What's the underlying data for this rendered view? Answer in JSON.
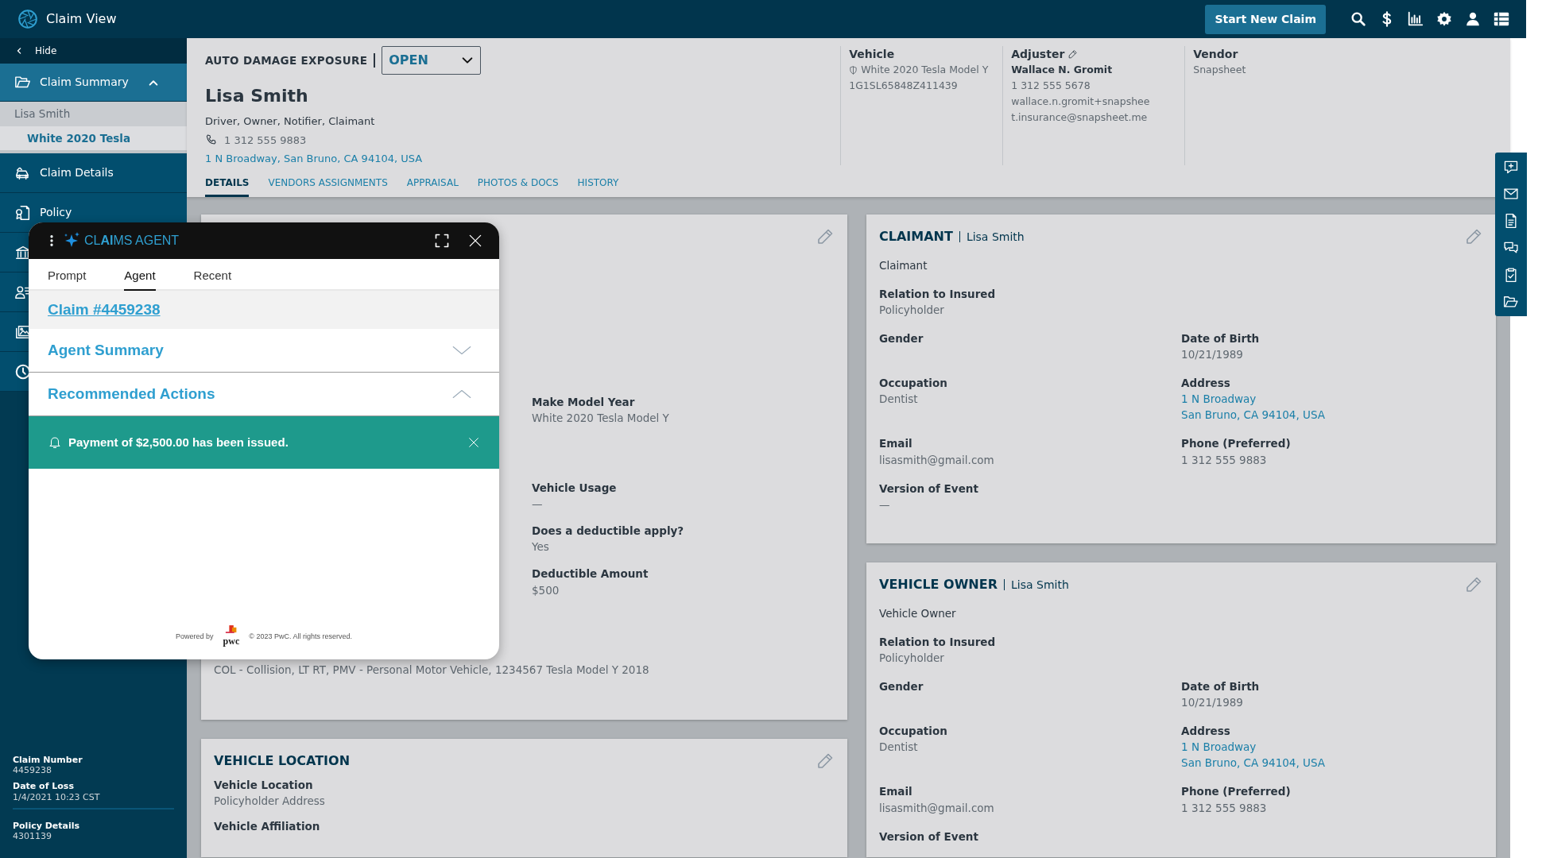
{
  "topbar": {
    "title": "Claim View",
    "start_button": "Start New Claim"
  },
  "sidebar": {
    "hide": "Hide",
    "items": [
      {
        "kind": "group",
        "label": "Claim Summary",
        "selected": true,
        "expanded": true,
        "children": [
          {
            "label": "Lisa Smith",
            "selected": false
          },
          {
            "label": "White 2020 Tesla",
            "selected": true
          }
        ]
      },
      {
        "kind": "item",
        "label": "Claim Details",
        "selected": false
      },
      {
        "kind": "item",
        "label": "Policy",
        "selected": false
      }
    ],
    "details": [
      {
        "label": "Claim Number",
        "value": "4459238"
      },
      {
        "label": "Date of Loss",
        "value": "1/4/2021 10:23 CST"
      },
      {
        "label": "Policy Details",
        "value": "4301139"
      }
    ]
  },
  "header": {
    "exposure": "AUTO DAMAGE EXPOSURE",
    "status": "OPEN",
    "name": "Lisa Smith",
    "roles": "Driver, Owner, Notifier, Claimant",
    "phone": "1 312 555 9883",
    "address": "1 N Broadway, San Bruno, CA 94104, USA",
    "info": [
      {
        "title": "Vehicle",
        "editable": false,
        "lines": [
          {
            "text": "White 2020 Tesla Model Y",
            "kind": "shield"
          },
          {
            "text": "1G1SL65848Z411439",
            "kind": "plain"
          }
        ]
      },
      {
        "title": "Adjuster",
        "editable": true,
        "lines": [
          {
            "text": "Wallace N. Gromit",
            "kind": "bold"
          },
          {
            "text": "1 312 555 5678",
            "kind": "plain"
          },
          {
            "text": "wallace.n.gromit+snapsheet.insurance@snapsheet.me",
            "kind": "plain"
          }
        ]
      },
      {
        "title": "Vendor",
        "editable": false,
        "lines": [
          {
            "text": "Snapsheet",
            "kind": "plain"
          }
        ]
      }
    ],
    "tabs": [
      {
        "label": "DETAILS",
        "selected": true
      },
      {
        "label": "VENDORS ASSIGNMENTS",
        "selected": false
      },
      {
        "label": "APPRAISAL",
        "selected": false
      },
      {
        "label": "PHOTOS & DOCS",
        "selected": false
      },
      {
        "label": "HISTORY",
        "selected": false
      }
    ]
  },
  "vehicle_card": {
    "fields": [
      {
        "label": "Make Model Year",
        "value": "White 2020 Tesla Model Y"
      },
      {
        "label": "Vehicle Usage",
        "value": "—"
      },
      {
        "label": "Does a deductible apply?",
        "value": "Yes"
      },
      {
        "label": "Deductible Amount",
        "value": "$500"
      }
    ],
    "coverage": "COL - Collision, LT RT, PMV - Personal Motor Vehicle, 1234567 Tesla Model Y 2018"
  },
  "location_card": {
    "title": "VEHICLE LOCATION",
    "fields": [
      {
        "label": "Vehicle Location",
        "value": "Policyholder Address"
      },
      {
        "label": "Vehicle Affiliation"
      }
    ]
  },
  "party_cards": [
    {
      "title": "CLAIMANT",
      "name": "Lisa Smith",
      "role": "Claimant",
      "rows": [
        [
          {
            "label": "Relation to Insured",
            "value": [
              "Policyholder"
            ]
          }
        ],
        [
          {
            "label": "Gender"
          },
          {
            "label": "Date of Birth",
            "value": [
              "10/21/1989"
            ]
          }
        ],
        [
          {
            "label": "Occupation",
            "value": [
              "Dentist"
            ]
          },
          {
            "label": "Address",
            "link": true,
            "value": [
              "1 N Broadway",
              "San Bruno, CA 94104, USA"
            ]
          }
        ],
        [
          {
            "label": "Email",
            "value": [
              "lisasmith@gmail.com"
            ]
          },
          {
            "label": "Phone (Preferred)",
            "value": [
              "1 312 555 9883"
            ]
          }
        ],
        [
          {
            "label": "Version of Event",
            "value": [
              "—"
            ]
          }
        ]
      ]
    },
    {
      "title": "VEHICLE OWNER",
      "name": "Lisa Smith",
      "role": "Vehicle Owner",
      "rows": [
        [
          {
            "label": "Relation to Insured",
            "value": [
              "Policyholder"
            ]
          }
        ],
        [
          {
            "label": "Gender"
          },
          {
            "label": "Date of Birth",
            "value": [
              "10/21/1989"
            ]
          }
        ],
        [
          {
            "label": "Occupation",
            "value": [
              "Dentist"
            ]
          },
          {
            "label": "Address",
            "link": true,
            "value": [
              "1 N Broadway",
              "San Bruno, CA 94104, USA"
            ]
          }
        ],
        [
          {
            "label": "Email",
            "value": [
              "lisasmith@gmail.com"
            ]
          },
          {
            "label": "Phone (Preferred)",
            "value": [
              "1 312 555 9883"
            ]
          }
        ],
        [
          {
            "label": "Version of Event"
          }
        ]
      ]
    }
  ],
  "agent": {
    "title": "CL**AI**MS AGENT",
    "tabs": [
      {
        "label": "Prompt",
        "selected": false
      },
      {
        "label": "Agent",
        "selected": true
      },
      {
        "label": "Recent",
        "selected": false
      }
    ],
    "claim_link": "Claim #4459238",
    "sections": [
      {
        "title": "Agent Summary",
        "expanded": false
      },
      {
        "title": "Recommended Actions",
        "expanded": true
      }
    ],
    "alert": "Payment of $2,500.00 has been issued.",
    "footer": {
      "powered_by": "Powered by",
      "logo": "pwc",
      "copyright": "© 2023 PwC. All rights reserved."
    }
  }
}
